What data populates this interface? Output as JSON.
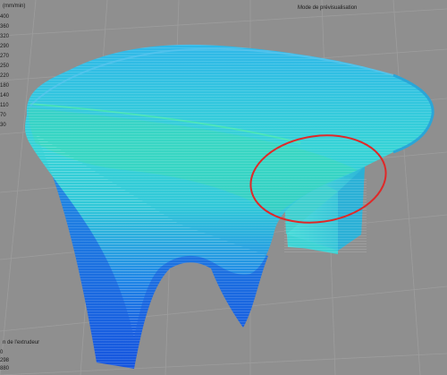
{
  "colors": {
    "background": "#8f8f8f",
    "grid": "#9b9b9b",
    "print_cyan": "#34d6d6",
    "print_blue": "#1560e0",
    "print_green": "#3ee08a",
    "highlight_circle": "#e02828"
  },
  "header": {
    "mode_label": "Mode de prévisualisation"
  },
  "speed_legend": {
    "title": "(mm/min)",
    "values": [
      "400",
      "360",
      "320",
      "290",
      "270",
      "250",
      "220",
      "180",
      "140",
      "110",
      "70",
      "30"
    ]
  },
  "extruder_legend": {
    "title": "n de l'extrudeur",
    "values": [
      "0",
      "298",
      "880"
    ]
  }
}
